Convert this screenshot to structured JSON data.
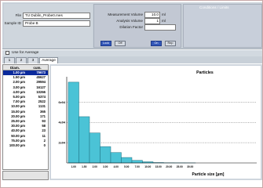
{
  "file_panel": {
    "file_label": "File",
    "file_value": "TU Dublin_Probe0.mes",
    "sample_label": "Sample ID",
    "sample_value": "Probe B"
  },
  "measurement": {
    "volume_label": "Measurement Volume",
    "volume_value": "10.0",
    "volume_unit": "ml",
    "analysis_label": "Analysis Volume",
    "analysis_value": "1",
    "analysis_unit": "ml",
    "dilution_label": "Dilution Factor",
    "dilution_value": "",
    "buttons": [
      "Lock",
      "Off",
      "On",
      "Rep"
    ]
  },
  "conditions": {
    "title": "Conditions / Limits"
  },
  "checkbox": {
    "label": "Use for Average",
    "checked": false
  },
  "tabs": [
    "1",
    "2",
    "3",
    "Average"
  ],
  "active_tab": "Average",
  "table": {
    "headers": [
      "Diam.",
      "cum."
    ],
    "rows": [
      [
        "1.00 µm",
        "79673"
      ],
      [
        "1.50 µm",
        "45627"
      ],
      [
        "2.00 µm",
        "29594"
      ],
      [
        "3.00 µm",
        "16127"
      ],
      [
        "4.00 µm",
        "10266"
      ],
      [
        "5.00 µm",
        "5374"
      ],
      [
        "7.00 µm",
        "2522"
      ],
      [
        "10.00 µm",
        "1131"
      ],
      [
        "15.00 µm",
        "365"
      ],
      [
        "20.00 µm",
        "171"
      ],
      [
        "25.00 µm",
        "93"
      ],
      [
        "30.00 µm",
        "58"
      ],
      [
        "40.00 µm",
        "23"
      ],
      [
        "50.00 µm",
        "11"
      ],
      [
        "75.00 µm",
        "2"
      ],
      [
        "100.00 µm",
        "0"
      ]
    ],
    "selected_index": 0
  },
  "chart_data": {
    "type": "bar",
    "title": "Particles",
    "xlabel": "Particle size [µm]",
    "ylabel": "",
    "categories": [
      "1.00",
      "1.50",
      "2.00",
      "3.00",
      "4.00",
      "5.00",
      "7.00",
      "10.00",
      "15.00",
      "20.00",
      "25.00",
      "30.00"
    ],
    "values": [
      79673,
      45627,
      29594,
      16127,
      10266,
      5374,
      2522,
      1131,
      365,
      171,
      93,
      58
    ],
    "yticks": [
      "2e04",
      "4e04",
      "6e04"
    ],
    "ytick_values": [
      20000,
      40000,
      60000
    ],
    "ylim": [
      0,
      85000
    ],
    "grid": "horizontal dotted",
    "bar_color": "#4bc3d6"
  }
}
